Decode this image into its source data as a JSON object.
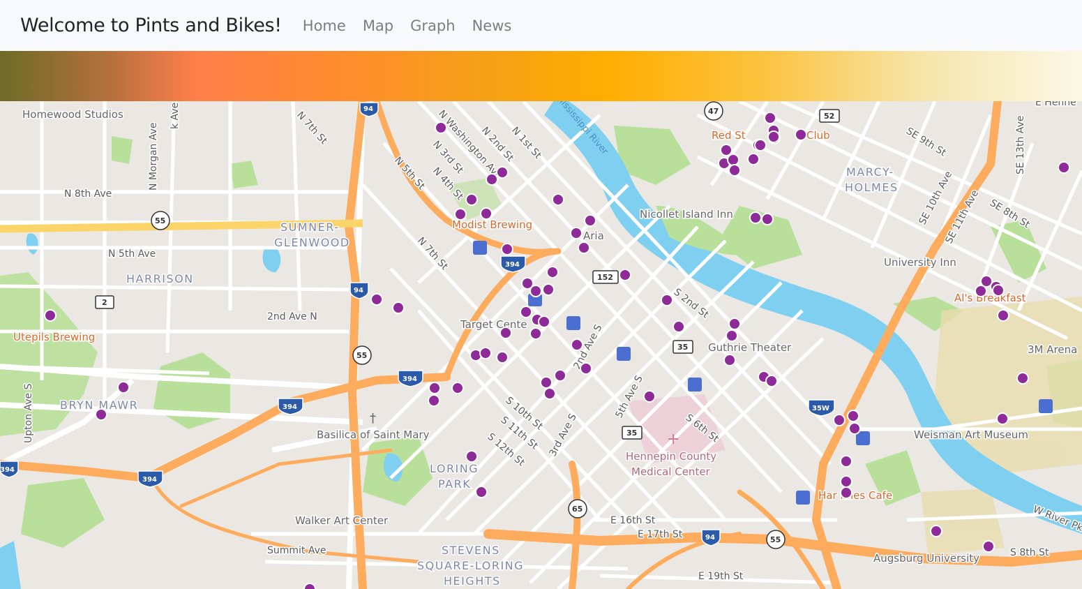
{
  "navbar": {
    "brand": "Welcome to Pints and Bikes!",
    "links": [
      "Home",
      "Map",
      "Graph",
      "News"
    ]
  },
  "map": {
    "colors": {
      "land": "#ebe8e4",
      "water": "#7fd0f0",
      "park": "#b9e09a",
      "highway": "#fdab5c",
      "road": "#ffffff",
      "marker": "#8e2b99"
    },
    "neighborhoods": [
      {
        "id": "sumner",
        "lines": [
          "SUMNER-",
          "GLENWOOD"
        ]
      },
      {
        "id": "harrison",
        "lines": [
          "HARRISON"
        ]
      },
      {
        "id": "bryn-mawr",
        "lines": [
          "BRYN MAWR"
        ]
      },
      {
        "id": "loring-park",
        "lines": [
          "LORING",
          "PARK"
        ]
      },
      {
        "id": "stevens-square",
        "lines": [
          "STEVENS",
          "SQUARE-LORING",
          "HEIGHTS"
        ]
      },
      {
        "id": "marcy-holmes",
        "lines": [
          "MARCY-",
          "HOLMES"
        ]
      }
    ],
    "poi_labels": {
      "homewood": "Homewood Studios",
      "utepils": "Utepils Brewing",
      "modist": "Modist Brewing",
      "target_center": "Target Cente",
      "basilica": "Basilica of Saint Mary",
      "walker": "Walker Art Center",
      "nicollet_inn": "Nicollet Island Inn",
      "guthrie": "Guthrie Theater",
      "hennepin1": "Hennepin County",
      "hennepin2": "Medical Center",
      "weisman": "Weisman Art Museum",
      "university_inn": "University Inn",
      "als": "Al's Breakfast",
      "arena": "3M Arena",
      "harmony": "Har    imes Cafe",
      "augsburg": "Augsburg University",
      "red_st": "Red St",
      "club": "Club",
      "aria": "Aria"
    },
    "street_labels": {
      "n8th": "N 8th Ave",
      "n5th": "N 5th Ave",
      "ave2n": "2nd Ave N",
      "morgan": "N Morgan Ave",
      "upton": "Upton Ave S",
      "n7th_a": "N 7th St",
      "n7th_b": "N 7th St",
      "washington": "N Washington Ave",
      "n2nd": "N 2nd St",
      "n1st": "N 1st St",
      "n3rd": "N 3rd St",
      "n4th": "N 4th St",
      "n5th_st": "N 5th St",
      "s2nd": "S 2nd St",
      "s6th": "S 6th St",
      "s10th": "S 10th St",
      "s11th": "S 11th St",
      "s12th": "S 12th St",
      "ave3s": "3rd Ave S",
      "ave2s": "2nd Ave S",
      "ave5s": "5th Ave S",
      "e16": "E 16th St",
      "e17": "E 17th St",
      "e19": "E 19th St",
      "summit": "Summit Ave",
      "se9": "SE 9th St",
      "se8": "SE 8th St",
      "se10": "SE 10th Ave",
      "se11": "SE 11th Ave",
      "se13": "SE 13th Ave",
      "s8th": "S 8th St",
      "wriver": "W River Pk",
      "hennepin_top": "E Henne",
      "river": "Mississippi River",
      "k_ave": "k Ave"
    },
    "shields": [
      "94",
      "55",
      "2",
      "394",
      "152",
      "35",
      "35W",
      "65",
      "47",
      "52"
    ],
    "marker_count": 78
  }
}
